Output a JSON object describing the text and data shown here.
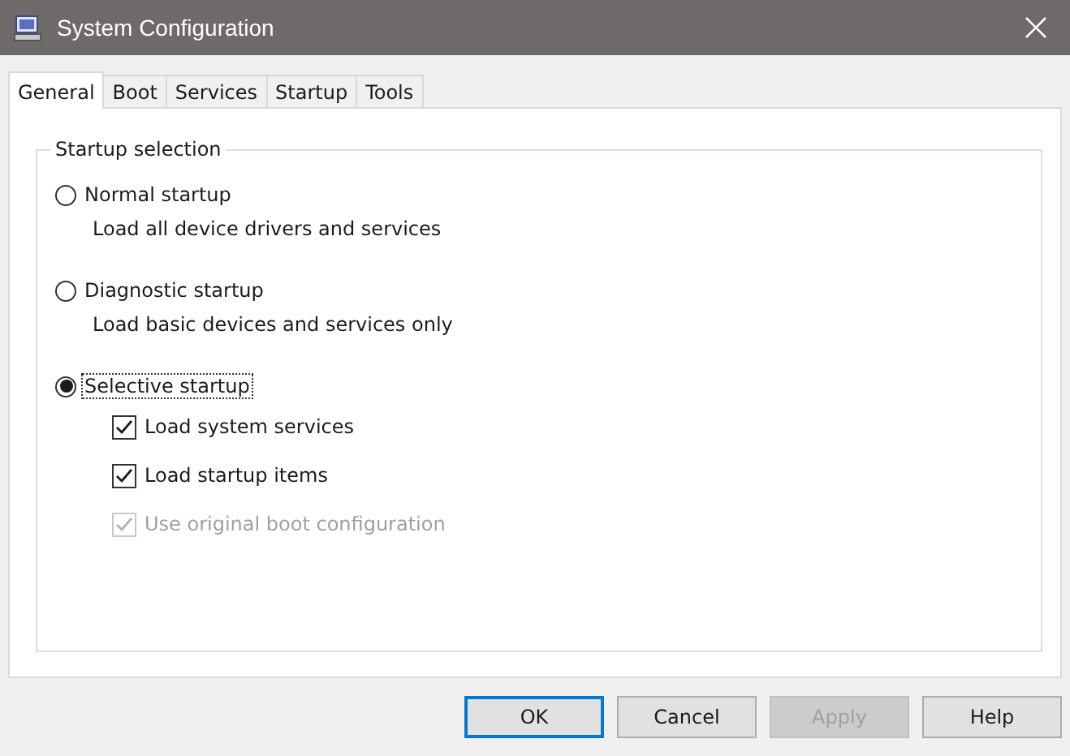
{
  "window": {
    "title": "System Configuration"
  },
  "tabs": [
    {
      "label": "General",
      "selected": true
    },
    {
      "label": "Boot",
      "selected": false
    },
    {
      "label": "Services",
      "selected": false
    },
    {
      "label": "Startup",
      "selected": false
    },
    {
      "label": "Tools",
      "selected": false
    }
  ],
  "group": {
    "title": "Startup selection",
    "options": [
      {
        "kind": "radio",
        "label": "Normal startup",
        "description": "Load all device drivers and services",
        "selected": false,
        "focused": false
      },
      {
        "kind": "radio",
        "label": "Diagnostic startup",
        "description": "Load basic devices and services only",
        "selected": false,
        "focused": false
      },
      {
        "kind": "radio",
        "label": "Selective startup",
        "selected": true,
        "focused": true
      },
      {
        "kind": "checkbox",
        "label": "Load system services",
        "checked": true,
        "disabled": false
      },
      {
        "kind": "checkbox",
        "label": "Load startup items",
        "checked": true,
        "disabled": false
      },
      {
        "kind": "checkbox",
        "label": "Use original boot configuration",
        "checked": true,
        "disabled": true
      }
    ]
  },
  "buttons": [
    {
      "label": "OK",
      "default": true,
      "disabled": false
    },
    {
      "label": "Cancel",
      "default": false,
      "disabled": false
    },
    {
      "label": "Apply",
      "default": false,
      "disabled": true
    },
    {
      "label": "Help",
      "default": false,
      "disabled": false
    }
  ]
}
